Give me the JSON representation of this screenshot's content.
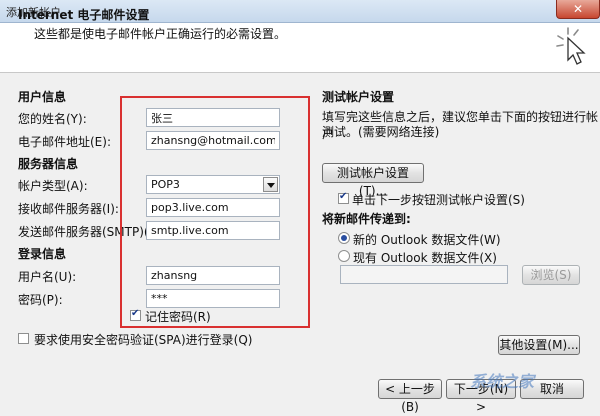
{
  "window": {
    "title": "添加新帐户",
    "close_glyph": "✕"
  },
  "header": {
    "title": "Internet 电子邮件设置",
    "subtitle": "这些都是使电子邮件帐户正确运行的必需设置。"
  },
  "user_info": {
    "section": "用户信息",
    "name_label": "您的姓名(Y):",
    "name_value": "张三",
    "email_label": "电子邮件地址(E):",
    "email_value": "zhansng@hotmail.com"
  },
  "server_info": {
    "section": "服务器信息",
    "account_type_label": "帐户类型(A):",
    "account_type_value": "POP3",
    "incoming_label": "接收邮件服务器(I):",
    "incoming_value": "pop3.live.com",
    "outgoing_label": "发送邮件服务器(SMTP)(O):",
    "outgoing_value": "smtp.live.com"
  },
  "login_info": {
    "section": "登录信息",
    "username_label": "用户名(U):",
    "username_value": "zhansng",
    "password_label": "密码(P):",
    "password_value": "***",
    "remember_label": "记住密码(R)",
    "remember_checked": true,
    "spa_label": "要求使用安全密码验证(SPA)进行登录(Q)",
    "spa_checked": false
  },
  "test_settings": {
    "section": "测试帐户设置",
    "desc_line1": "填写完这些信息之后，建议您单击下面的按钮进行帐户",
    "desc_line2": "测试。(需要网络连接)",
    "test_button": "测试帐户设置(T)...",
    "auto_test_label": "单击下一步按钮测试帐户设置(S)",
    "auto_test_checked": true
  },
  "deliver_to": {
    "section": "将新邮件传递到:",
    "new_file_label": "新的 Outlook 数据文件(W)",
    "existing_file_label": "现有 Outlook 数据文件(X)",
    "selected": "new",
    "browse_button": "浏览(S)"
  },
  "buttons": {
    "more_settings": "其他设置(M)...",
    "back": "< 上一步(B)",
    "next": "下一步(N) >",
    "cancel": "取消"
  },
  "watermark": "系统之家",
  "colors": {
    "highlight": "#d93030",
    "titlebar": "#c6d8ec"
  }
}
